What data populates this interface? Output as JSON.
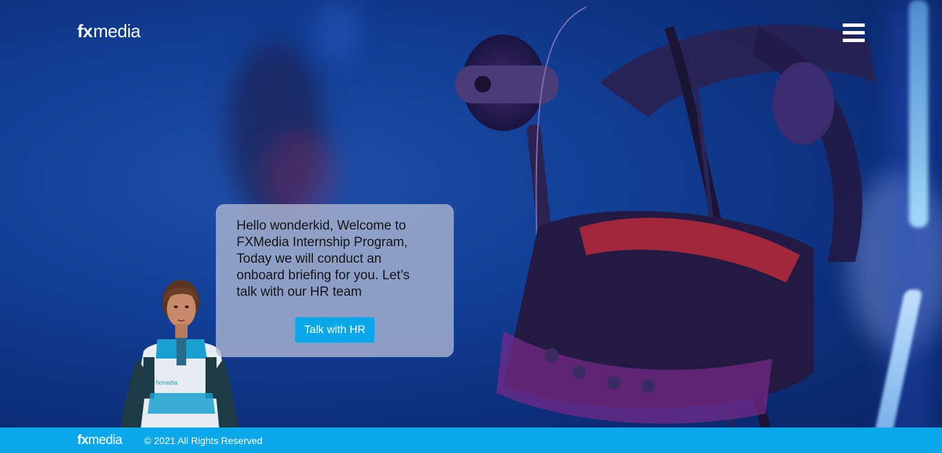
{
  "header": {
    "logo": {
      "fx": "fx",
      "media": "media"
    },
    "menu_icon": "hamburger-menu-icon"
  },
  "dialog": {
    "message": "Hello wonderkid, Welcome to FXMedia Internship Program, Today we will conduct an onboard briefing for you. Let’s talk with our HR team",
    "button_label": "Talk with HR"
  },
  "footer": {
    "logo": {
      "fx": "fx",
      "media": "media"
    },
    "copyright": "© 2021 All Rights Reserved"
  },
  "colors": {
    "accent": "#0aa7ea",
    "background": "#123f96",
    "dialog_bg": "#afb9d2"
  }
}
